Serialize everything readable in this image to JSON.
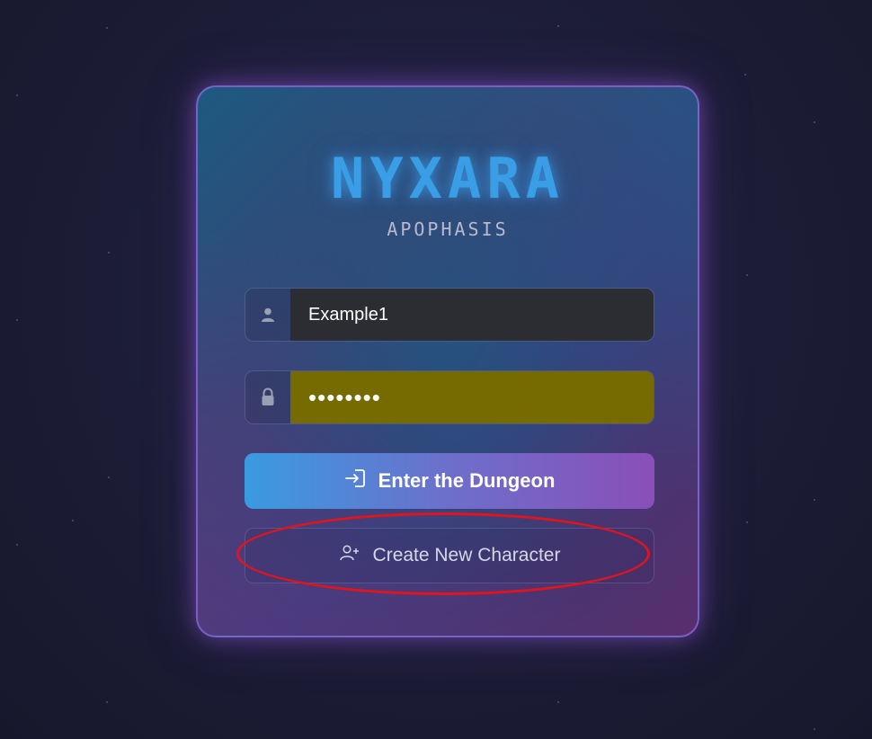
{
  "app": {
    "title": "NYXARA",
    "subtitle": "APOPHASIS"
  },
  "login": {
    "username_value": "Example1",
    "password_value": "••••••••",
    "enter_label": "Enter the Dungeon",
    "create_label": "Create New Character"
  },
  "icons": {
    "user": "user-icon",
    "lock": "lock-icon",
    "enter": "login-arrow-icon",
    "create": "user-plus-icon"
  },
  "colors": {
    "logo": "#3a9ee6",
    "button_gradient_start": "#3a9be0",
    "button_gradient_end": "#8a4fb8",
    "password_autofill_bg": "#756b00",
    "annotation": "#e0141c"
  }
}
